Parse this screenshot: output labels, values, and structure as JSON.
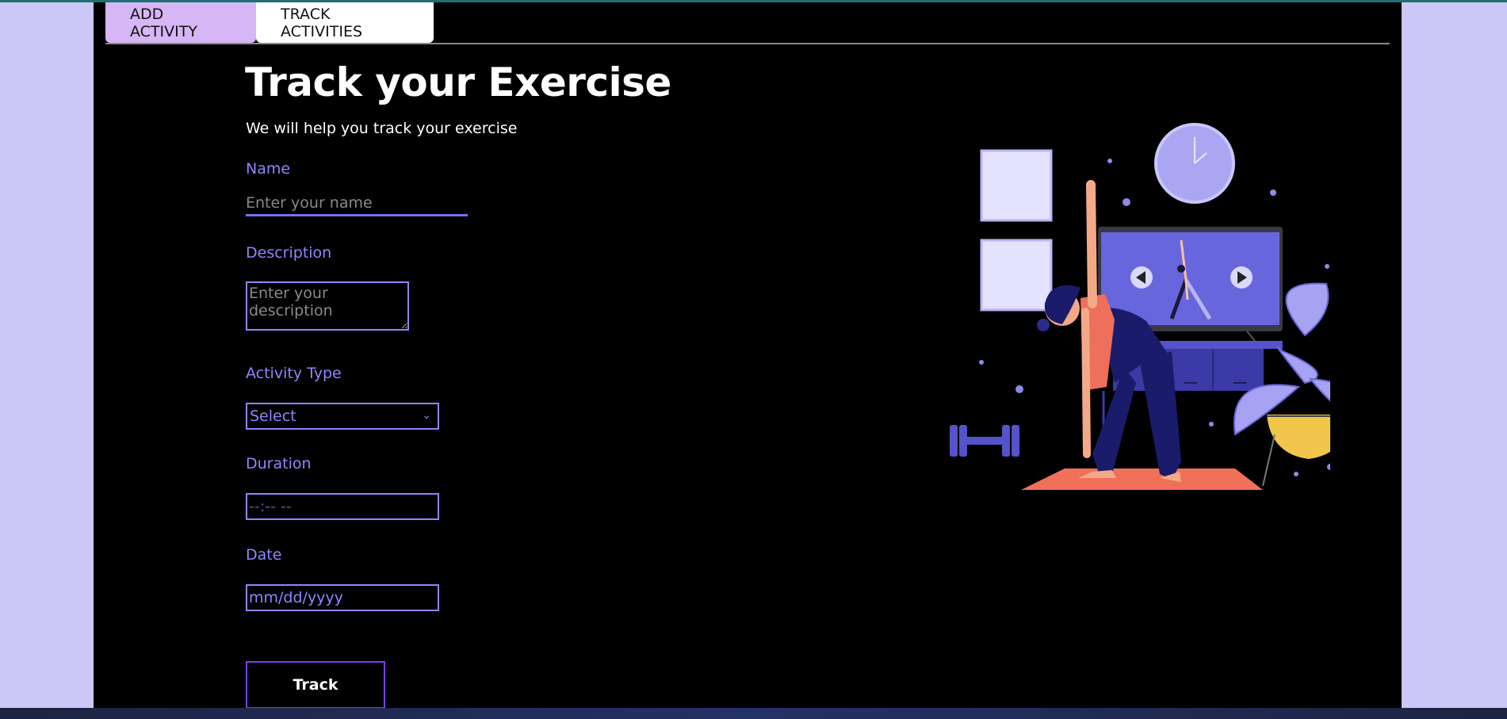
{
  "tabs": [
    {
      "label": "ADD ACTIVITY",
      "active": true
    },
    {
      "label": "TRACK ACTIVITIES",
      "active": false
    }
  ],
  "header": {
    "title": "Track your Exercise",
    "subtitle": "We will help you track your exercise"
  },
  "form": {
    "name": {
      "label": "Name",
      "placeholder": "Enter your name"
    },
    "description": {
      "label": "Description",
      "placeholder": "Enter your description"
    },
    "activity_type": {
      "label": "Activity Type",
      "selected": "Select"
    },
    "duration": {
      "label": "Duration",
      "value": "--:-- --"
    },
    "date": {
      "label": "Date",
      "value": "mm/dd/yyyy"
    },
    "submit_label": "Track"
  },
  "colors": {
    "accent": "#8f86ff",
    "active_tab": "#d6b6f4",
    "page_background": "#cbc8f7",
    "panel": "#000000",
    "button_border": "#7b3fe6"
  },
  "illustration": "yoga-exercise-illustration"
}
